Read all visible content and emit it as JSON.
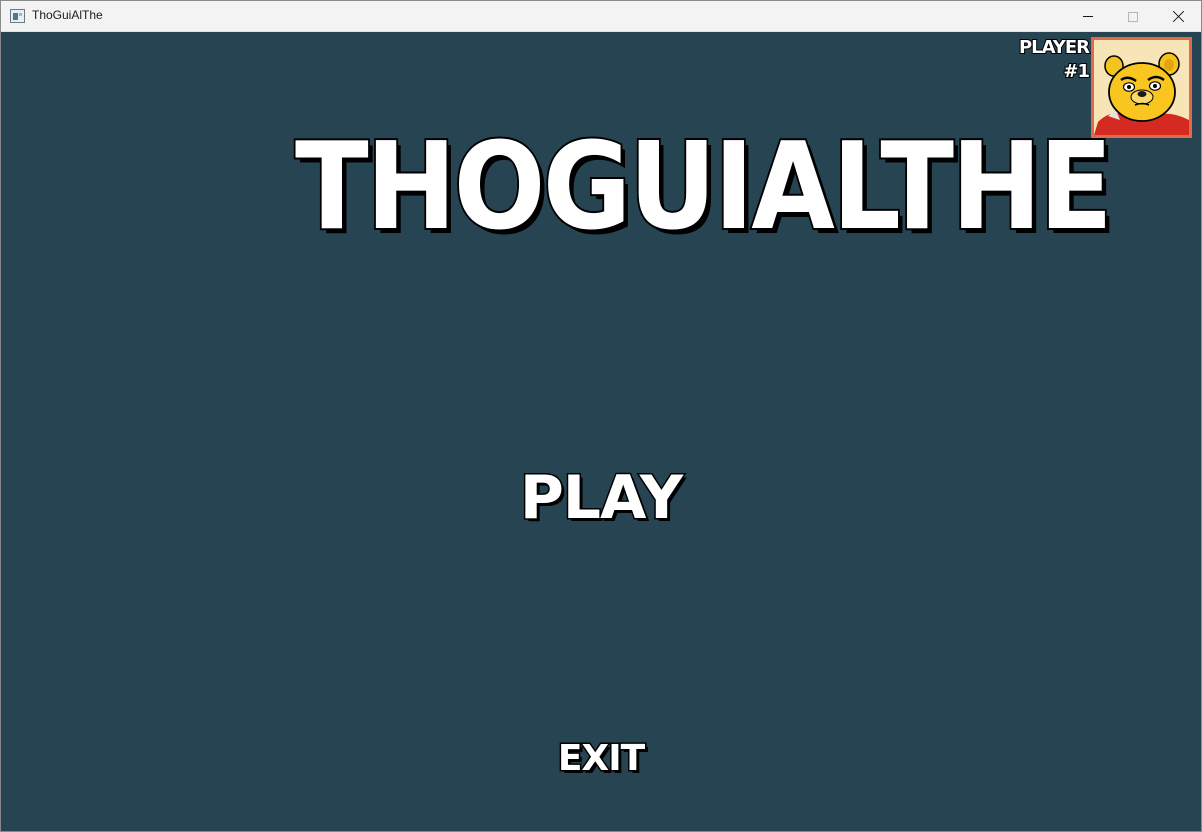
{
  "window": {
    "title": "ThoGuiAlThe",
    "controls": {
      "minimize_icon": "minimize-icon",
      "maximize_icon": "maximize-icon",
      "close_icon": "close-icon"
    }
  },
  "game": {
    "title": "THOGUIALTHE",
    "player_label": "PLAYER #1",
    "avatar_icon": "bear-face-icon",
    "menu": {
      "play_label": "PLAY",
      "exit_label": "EXIT"
    }
  },
  "colors": {
    "background": "#274452",
    "title_bar": "#f3f3f3",
    "text_fill": "#ffffff",
    "text_outline": "#000000",
    "avatar_border": "#e06a4c",
    "avatar_background": "#f7e5b8"
  }
}
